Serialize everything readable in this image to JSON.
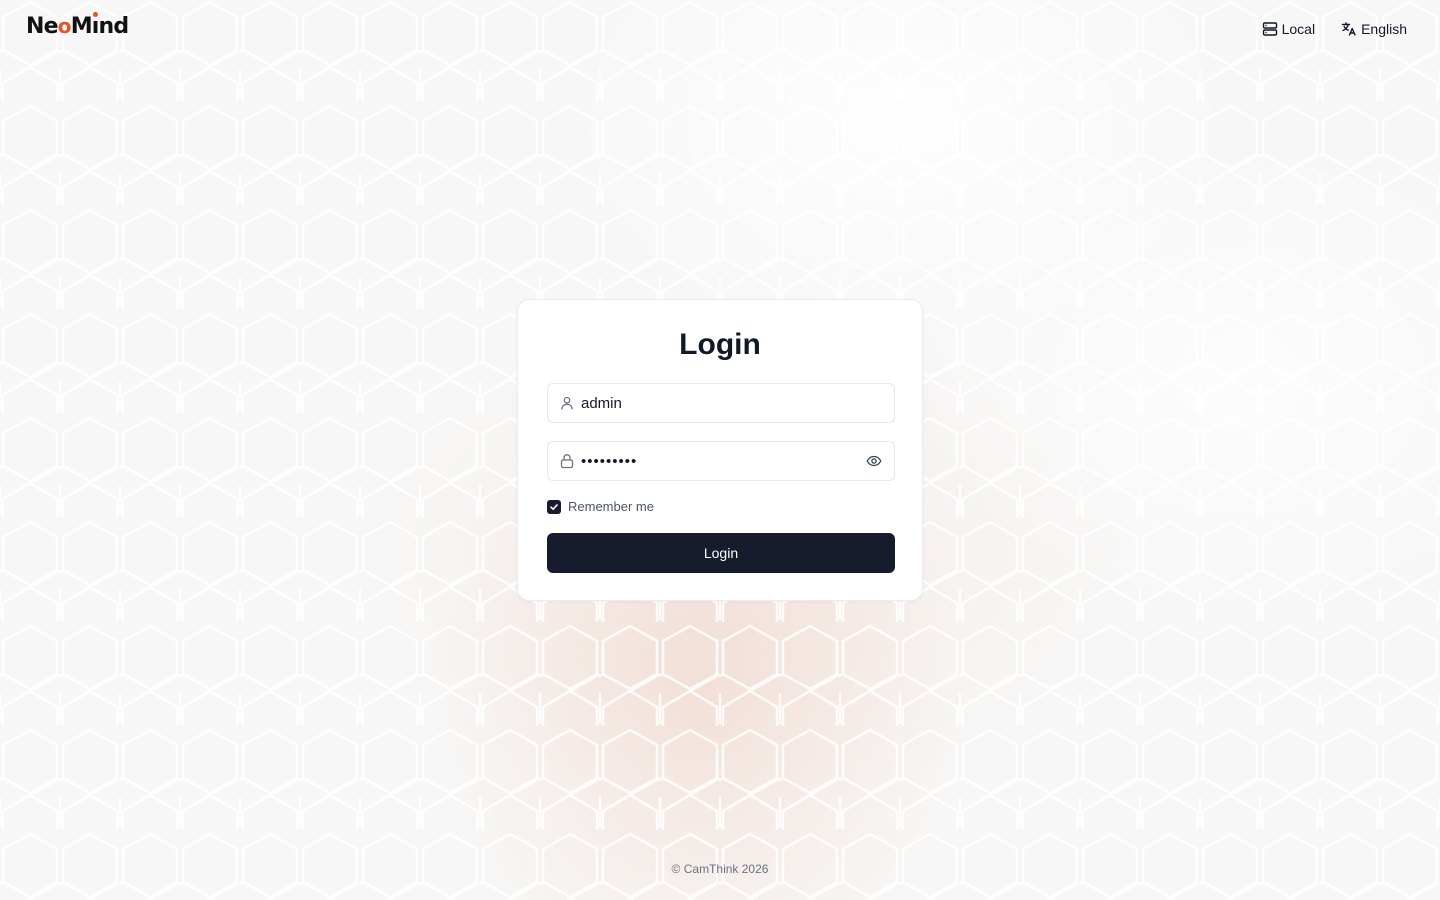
{
  "brand": {
    "logo_parts": [
      "Ne",
      "o",
      "M",
      "ı",
      "nd"
    ],
    "logo_text": "NeoMind",
    "accent_color": "#e8532c"
  },
  "header": {
    "server": {
      "label": "Local",
      "icon": "server-icon"
    },
    "language": {
      "label": "English",
      "icon": "translate-icon"
    }
  },
  "login": {
    "title": "Login",
    "username": {
      "value": "admin",
      "icon": "user-icon"
    },
    "password": {
      "value": "•••••••••",
      "icon": "lock-icon",
      "toggle_icon": "eye-icon"
    },
    "remember_me": {
      "label": "Remember me",
      "checked": true
    },
    "submit_label": "Login",
    "button_color": "#161b2e"
  },
  "footer": {
    "copyright": "© CamThink 2026"
  }
}
